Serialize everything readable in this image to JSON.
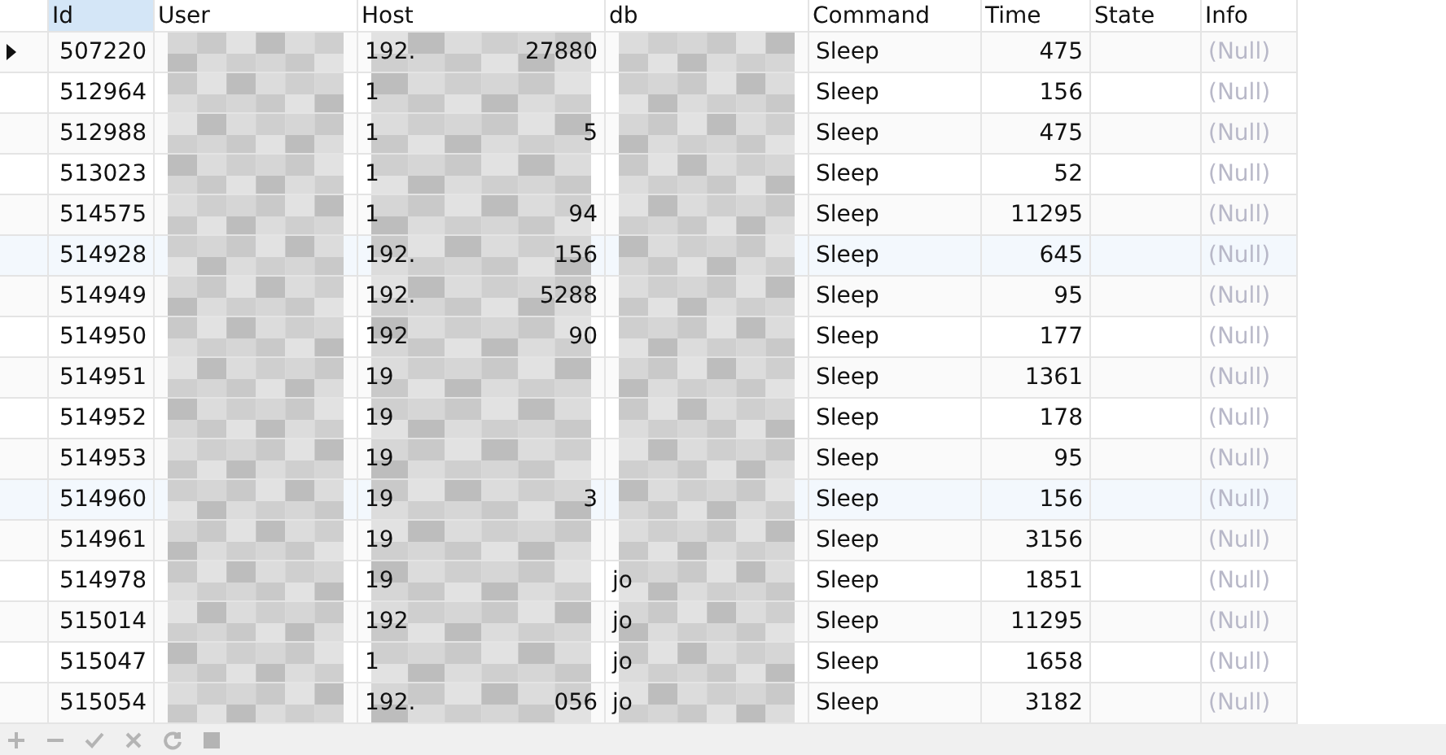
{
  "columns": [
    {
      "label": "Id",
      "selected": true
    },
    {
      "label": "User",
      "selected": false
    },
    {
      "label": "Host",
      "selected": false
    },
    {
      "label": "db",
      "selected": false
    },
    {
      "label": "Command",
      "selected": false
    },
    {
      "label": "Time",
      "selected": false
    },
    {
      "label": "State",
      "selected": false
    },
    {
      "label": "Info",
      "selected": false
    }
  ],
  "rows": [
    {
      "current": true,
      "highlighted": false,
      "id": "507220",
      "host": {
        "start": "192.",
        "end": "27880"
      },
      "db": {},
      "command": "Sleep",
      "time": "475",
      "info": "(Null)"
    },
    {
      "current": false,
      "highlighted": false,
      "id": "512964",
      "host": {
        "start": "1"
      },
      "db": {},
      "command": "Sleep",
      "time": "156",
      "info": "(Null)"
    },
    {
      "current": false,
      "highlighted": false,
      "id": "512988",
      "host": {
        "start": "1",
        "end": "5"
      },
      "db": {},
      "command": "Sleep",
      "time": "475",
      "info": "(Null)"
    },
    {
      "current": false,
      "highlighted": false,
      "id": "513023",
      "host": {
        "start": "1"
      },
      "db": {},
      "command": "Sleep",
      "time": "52",
      "info": "(Null)"
    },
    {
      "current": false,
      "highlighted": false,
      "id": "514575",
      "host": {
        "start": "1",
        "end": "94"
      },
      "db": {},
      "command": "Sleep",
      "time": "11295",
      "info": "(Null)"
    },
    {
      "current": false,
      "highlighted": true,
      "id": "514928",
      "host": {
        "start": "192.",
        "end": "156"
      },
      "db": {},
      "command": "Sleep",
      "time": "645",
      "info": "(Null)"
    },
    {
      "current": false,
      "highlighted": false,
      "id": "514949",
      "host": {
        "start": "192.",
        "end": "5288"
      },
      "db": {},
      "command": "Sleep",
      "time": "95",
      "info": "(Null)"
    },
    {
      "current": false,
      "highlighted": false,
      "id": "514950",
      "host": {
        "start": "192",
        "end": "90"
      },
      "db": {},
      "command": "Sleep",
      "time": "177",
      "info": "(Null)"
    },
    {
      "current": false,
      "highlighted": false,
      "id": "514951",
      "host": {
        "start": "19"
      },
      "db": {},
      "command": "Sleep",
      "time": "1361",
      "info": "(Null)"
    },
    {
      "current": false,
      "highlighted": false,
      "id": "514952",
      "host": {
        "start": "19"
      },
      "db": {},
      "command": "Sleep",
      "time": "178",
      "info": "(Null)"
    },
    {
      "current": false,
      "highlighted": false,
      "id": "514953",
      "host": {
        "start": "19"
      },
      "db": {},
      "command": "Sleep",
      "time": "95",
      "info": "(Null)"
    },
    {
      "current": false,
      "highlighted": true,
      "id": "514960",
      "host": {
        "start": "19",
        "end": "3"
      },
      "db": {},
      "command": "Sleep",
      "time": "156",
      "info": "(Null)"
    },
    {
      "current": false,
      "highlighted": false,
      "id": "514961",
      "host": {
        "start": "19"
      },
      "db": {},
      "command": "Sleep",
      "time": "3156",
      "info": "(Null)"
    },
    {
      "current": false,
      "highlighted": false,
      "id": "514978",
      "host": {
        "start": "19"
      },
      "db": {
        "start": "jo"
      },
      "command": "Sleep",
      "time": "1851",
      "info": "(Null)"
    },
    {
      "current": false,
      "highlighted": false,
      "id": "515014",
      "host": {
        "start": "192"
      },
      "db": {
        "start": "jo"
      },
      "command": "Sleep",
      "time": "11295",
      "info": "(Null)"
    },
    {
      "current": false,
      "highlighted": false,
      "id": "515047",
      "host": {
        "start": "1"
      },
      "db": {
        "start": "jo"
      },
      "command": "Sleep",
      "time": "1658",
      "info": "(Null)"
    },
    {
      "current": false,
      "highlighted": false,
      "id": "515054",
      "host": {
        "start": "192.",
        "end": "056"
      },
      "db": {
        "start": "jo"
      },
      "command": "Sleep",
      "time": "3182",
      "info": "(Null)"
    }
  ]
}
